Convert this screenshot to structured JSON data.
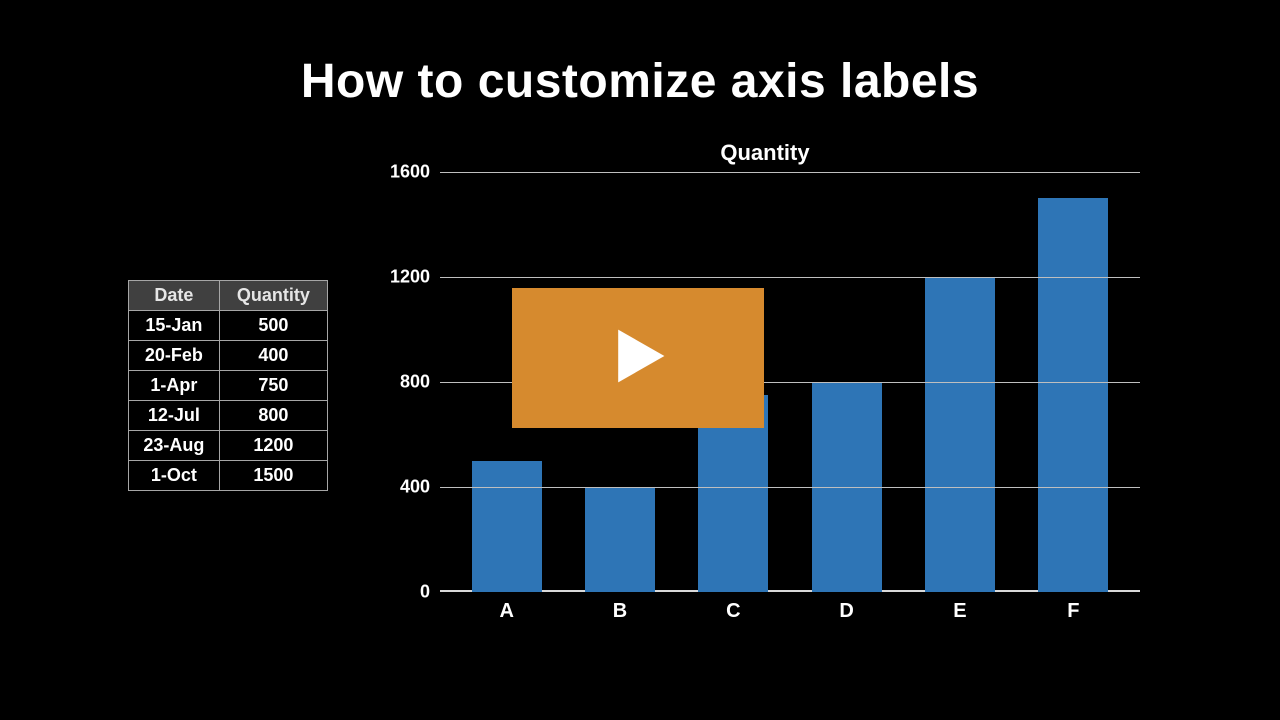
{
  "title": "How to customize axis labels",
  "table": {
    "headers": [
      "Date",
      "Quantity"
    ],
    "rows": [
      [
        "15-Jan",
        "500"
      ],
      [
        "20-Feb",
        "400"
      ],
      [
        "1-Apr",
        "750"
      ],
      [
        "12-Jul",
        "800"
      ],
      [
        "23-Aug",
        "1200"
      ],
      [
        "1-Oct",
        "1500"
      ]
    ]
  },
  "chart_data": {
    "type": "bar",
    "title": "Quantity",
    "categories": [
      "A",
      "B",
      "C",
      "D",
      "E",
      "F"
    ],
    "values": [
      500,
      400,
      750,
      800,
      1200,
      1500
    ],
    "xlabel": "",
    "ylabel": "",
    "ylim": [
      0,
      1600
    ],
    "y_ticks": [
      0,
      400,
      800,
      1200,
      1600
    ],
    "bar_color": "#2e75b6"
  },
  "play_button": {
    "label": "Play video"
  }
}
